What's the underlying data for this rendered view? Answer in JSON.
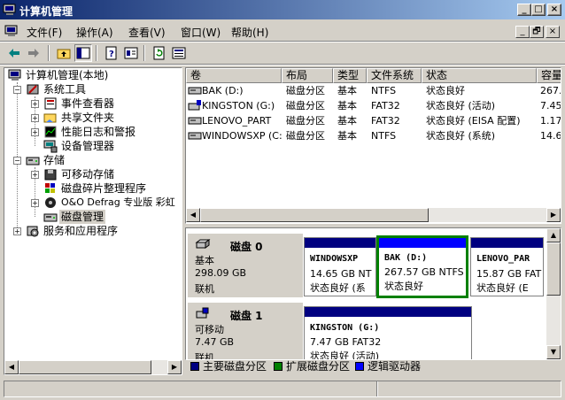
{
  "window": {
    "title": "计算机管理",
    "minimize_glyph": "_",
    "maximize_glyph": "□",
    "close_glyph": "×"
  },
  "menu": [
    "文件(F)",
    "操作(A)",
    "查看(V)",
    "窗口(W)",
    "帮助(H)"
  ],
  "mdi_buttons": [
    "_",
    "🗗",
    "×"
  ],
  "toolbar": [
    "back-icon",
    "forward-icon",
    "up-folder-icon",
    "show-hide-tree-icon",
    "help-icon",
    "properties-icon",
    "refresh-icon",
    "export-list-icon"
  ],
  "tree": [
    {
      "label": "计算机管理(本地)",
      "icon": "computer-management-icon",
      "expander": ""
    },
    {
      "label": "系统工具",
      "icon": "system-tools-icon",
      "expander": "−"
    },
    {
      "label": "事件查看器",
      "icon": "event-viewer-icon",
      "expander": "+"
    },
    {
      "label": "共享文件夹",
      "icon": "shared-folders-icon",
      "expander": "+"
    },
    {
      "label": "性能日志和警报",
      "icon": "performance-logs-icon",
      "expander": "+"
    },
    {
      "label": "设备管理器",
      "icon": "device-manager-icon",
      "expander": ""
    },
    {
      "label": "存储",
      "icon": "storage-icon",
      "expander": "−"
    },
    {
      "label": "可移动存储",
      "icon": "removable-storage-icon",
      "expander": "+"
    },
    {
      "label": "磁盘碎片整理程序",
      "icon": "defragmenter-icon",
      "expander": ""
    },
    {
      "label": "O&O Defrag 专业版 彩虹",
      "icon": "oo-defrag-icon",
      "expander": "+"
    },
    {
      "label": "磁盘管理",
      "icon": "disk-management-icon",
      "expander": ""
    },
    {
      "label": "服务和应用程序",
      "icon": "services-apps-icon",
      "expander": "+"
    }
  ],
  "columns": [
    "卷",
    "布局",
    "类型",
    "文件系统",
    "状态",
    "容量"
  ],
  "volumes": [
    {
      "name": "BAK (D:)",
      "layout": "磁盘分区",
      "type": "基本",
      "fs": "NTFS",
      "status": "状态良好",
      "capacity": "267.",
      "icon": "drive-icon"
    },
    {
      "name": "KINGSTON (G:)",
      "layout": "磁盘分区",
      "type": "基本",
      "fs": "FAT32",
      "status": "状态良好 (活动)",
      "capacity": "7.45",
      "icon": "removable-drive-icon"
    },
    {
      "name": "LENOVO_PART",
      "layout": "磁盘分区",
      "type": "基本",
      "fs": "FAT32",
      "status": "状态良好 (EISA 配置)",
      "capacity": "1.17",
      "icon": "drive-icon"
    },
    {
      "name": "WINDOWSXP (C:)",
      "layout": "磁盘分区",
      "type": "基本",
      "fs": "NTFS",
      "status": "状态良好 (系统)",
      "capacity": "14.6",
      "icon": "drive-icon"
    }
  ],
  "disks": [
    {
      "title": "磁盘 0",
      "type": "基本",
      "size": "298.09 GB",
      "state": "联机",
      "icon": "hard-disk-icon",
      "partitions": [
        {
          "name": "WINDOWSXP",
          "line2": "14.65 GB NT",
          "line3": "状态良好 (系",
          "selected": false
        },
        {
          "name": "BAK  (D:)",
          "line2": "267.57 GB NTFS",
          "line3": "状态良好",
          "selected": true
        },
        {
          "name": "LENOVO_PAR",
          "line2": "15.87 GB FAT",
          "line3": "状态良好 (E",
          "selected": false
        }
      ]
    },
    {
      "title": "磁盘 1",
      "type": "可移动",
      "size": "7.47 GB",
      "state": "联机",
      "icon": "removable-disk-icon",
      "partitions": [
        {
          "name": "KINGSTON  (G:)",
          "line2": "7.47 GB FAT32",
          "line3": "状态良好 (活动)",
          "selected": false
        }
      ]
    }
  ],
  "legend": [
    {
      "label": "主要磁盘分区",
      "color": "#000080"
    },
    {
      "label": "扩展磁盘分区",
      "color": "#008000"
    },
    {
      "label": "逻辑驱动器",
      "color": "#0000ff"
    }
  ],
  "colors": {
    "primary_partition": "#000080",
    "selection_border": "#008000",
    "titlebar": "#0a246a"
  }
}
